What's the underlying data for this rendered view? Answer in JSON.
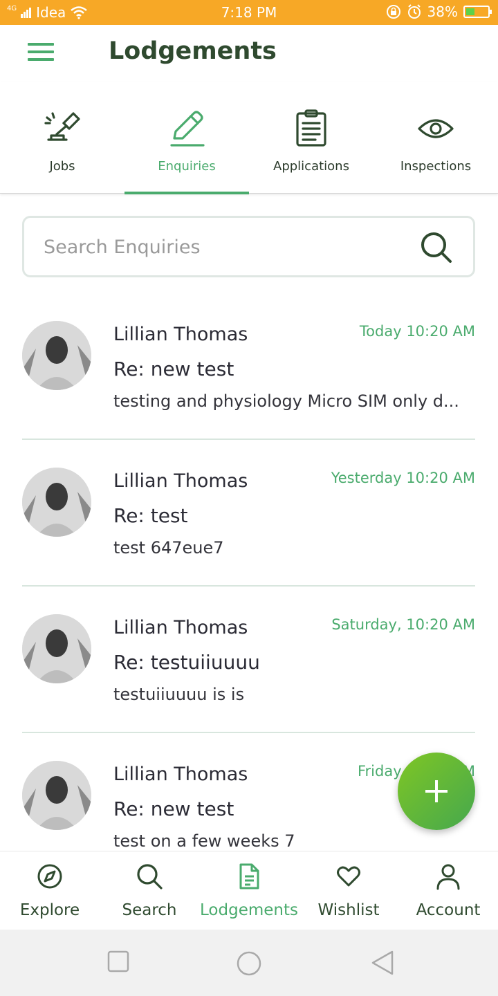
{
  "status_bar": {
    "network": "4G",
    "carrier": "Idea",
    "time": "7:18 PM",
    "battery": "38%"
  },
  "header": {
    "title": "Lodgements",
    "menu_icon": "hamburger-menu-icon"
  },
  "tabs": [
    {
      "label": "Jobs",
      "icon": "gavel-icon",
      "active": false
    },
    {
      "label": "Enquiries",
      "icon": "pen-icon",
      "active": true
    },
    {
      "label": "Applications",
      "icon": "clipboard-icon",
      "active": false
    },
    {
      "label": "Inspections",
      "icon": "eye-icon",
      "active": false
    }
  ],
  "search": {
    "placeholder": "Search Enquiries",
    "value": ""
  },
  "enquiries": [
    {
      "name": "Lillian Thomas",
      "subject": "Re: new test",
      "preview": "testing and physiology Micro SIM only d...",
      "time": "Today 10:20 AM"
    },
    {
      "name": "Lillian Thomas",
      "subject": "Re: test",
      "preview": "test 647eue7",
      "time": "Yesterday 10:20 AM"
    },
    {
      "name": "Lillian Thomas",
      "subject": "Re: testuiiuuuu",
      "preview": "testuiiuuuu is is",
      "time": "Saturday, 10:20 AM"
    },
    {
      "name": "Lillian Thomas",
      "subject": "Re: new test",
      "preview": "test on a few weeks 7",
      "time": "Friday 10:20 AM"
    }
  ],
  "bottom_nav": [
    {
      "label": "Explore",
      "icon": "compass-icon",
      "active": false
    },
    {
      "label": "Search",
      "icon": "search-icon",
      "active": false
    },
    {
      "label": "Lodgements",
      "icon": "document-icon",
      "active": true
    },
    {
      "label": "Wishlist",
      "icon": "heart-icon",
      "active": false
    },
    {
      "label": "Account",
      "icon": "user-icon",
      "active": false
    }
  ],
  "colors": {
    "accent": "#4aab6d",
    "dark_green": "#2f4a2f",
    "status_bar": "#f7a826",
    "fab_start": "#7fc624",
    "fab_end": "#45a84e"
  }
}
